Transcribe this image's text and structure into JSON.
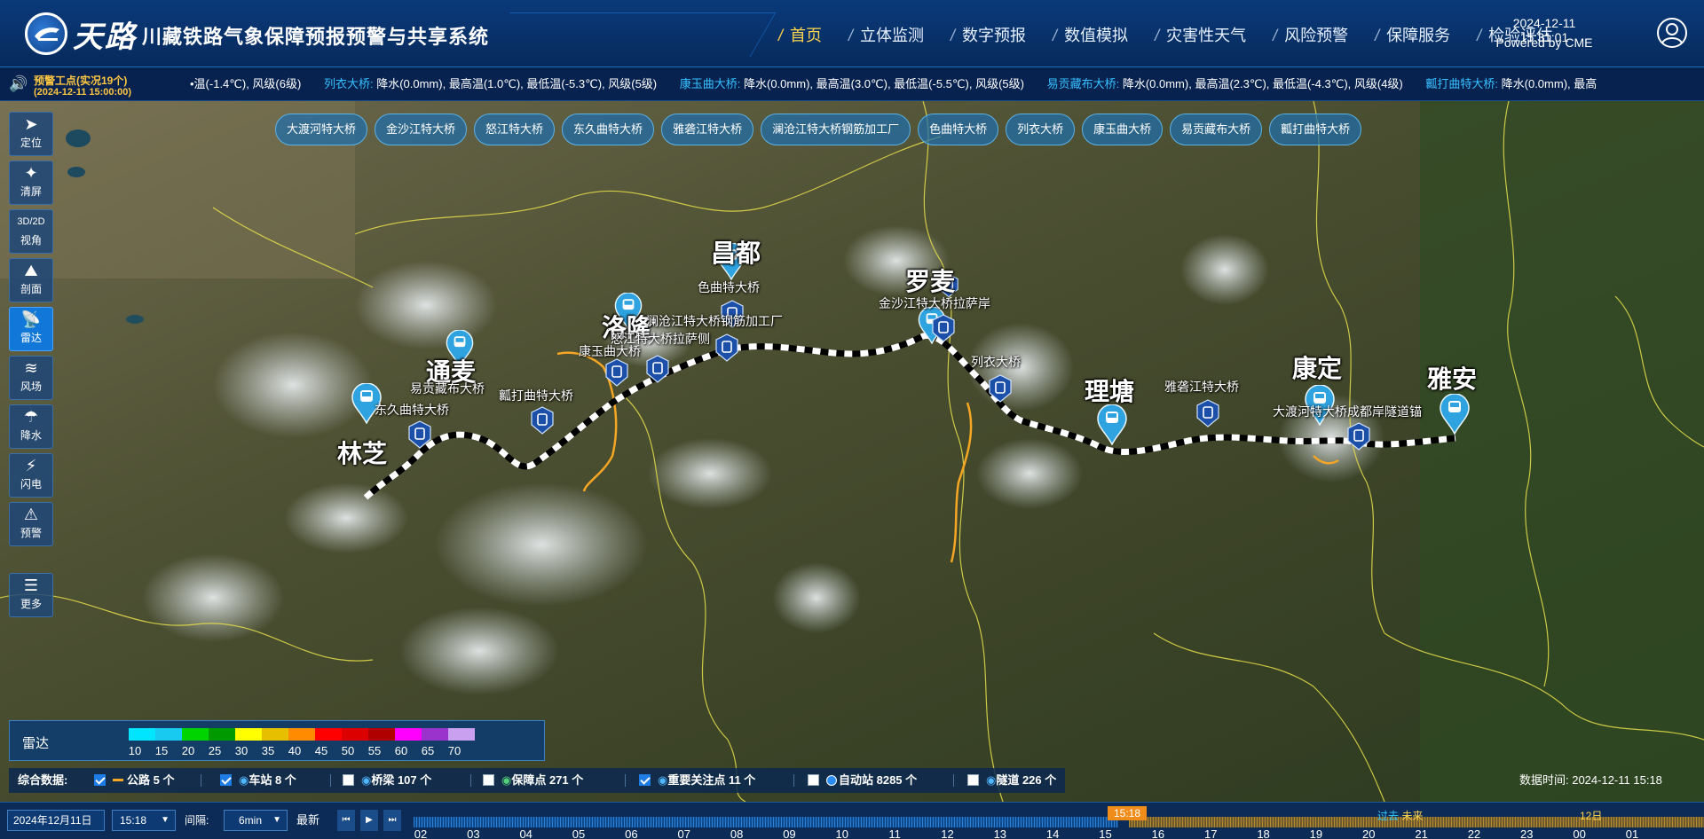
{
  "header": {
    "brand": "天路",
    "title": "川藏铁路气象保障预报预警与共享系统",
    "nav": [
      "首页",
      "立体监测",
      "数字预报",
      "数值模拟",
      "灾害性天气",
      "风险预警",
      "保障服务",
      "检验评估"
    ],
    "active_nav": "首页",
    "datetime": "2024-12-11 15:31:01",
    "powered_by": "Powered by CME"
  },
  "ticker": {
    "alert_title": "预警工点(实况19个)",
    "alert_time": "(2024-12-11 15:00:00)",
    "lead_fragment": "•温(-1.4℃), 风级(6级)",
    "items": [
      {
        "name": "列衣大桥:",
        "text": "降水(0.0mm), 最高温(1.0℃), 最低温(-5.3℃), 风级(5级)"
      },
      {
        "name": "康玉曲大桥:",
        "text": "降水(0.0mm), 最高温(3.0℃), 最低温(-5.5℃), 风级(5级)"
      },
      {
        "name": "易贡藏布大桥:",
        "text": "降水(0.0mm), 最高温(2.3℃), 最低温(-4.3℃), 风级(4级)"
      },
      {
        "name": "瓤打曲特大桥:",
        "text": "降水(0.0mm), 最高"
      }
    ]
  },
  "tools": [
    {
      "label": "定位",
      "icon": "locate-icon"
    },
    {
      "label": "清屏",
      "icon": "clear-icon"
    },
    {
      "label": "视角",
      "icon": "view-angle-icon"
    },
    {
      "label": "剖面",
      "icon": "profile-icon"
    },
    {
      "label": "雷达",
      "icon": "radar-icon"
    },
    {
      "label": "风场",
      "icon": "wind-icon"
    },
    {
      "label": "降水",
      "icon": "rain-icon"
    },
    {
      "label": "闪电",
      "icon": "lightning-icon"
    },
    {
      "label": "预警",
      "icon": "warning-icon"
    }
  ],
  "tool_more": {
    "label": "更多",
    "icon": "layers-icon"
  },
  "active_tool": "雷达",
  "bridge_pills": [
    "大渡河特大桥",
    "金沙江特大桥",
    "怒江特大桥",
    "东久曲特大桥",
    "雅砻江特大桥",
    "澜沧江特大桥钢筋加工厂",
    "色曲特大桥",
    "列衣大桥",
    "康玉曲大桥",
    "易贡藏布大桥",
    "瓤打曲特大桥"
  ],
  "map": {
    "cities": [
      "昌都",
      "罗麦",
      "洛隆",
      "通麦",
      "林芝",
      "理塘",
      "康定",
      "雅安"
    ],
    "pois": [
      "色曲特大桥",
      "澜沧江特大桥钢筋加工厂",
      "金沙江特大桥拉萨岸",
      "怒江特大桥拉萨侧",
      "康玉曲大桥",
      "列衣大桥",
      "易贡藏布大桥",
      "瓤打曲特大桥",
      "东久曲特大桥",
      "雅砻江特大桥",
      "大渡河特大桥成都岸隧道锚"
    ]
  },
  "legend": {
    "title": "雷达",
    "colors": [
      "#00e5ff",
      "#18c9f0",
      "#00d400",
      "#009a00",
      "#ffff00",
      "#e6c000",
      "#ff8c00",
      "#ff0000",
      "#dd0000",
      "#b00000",
      "#ff00ff",
      "#9a33cc",
      "#c9a0f0"
    ],
    "ticks": [
      "10",
      "15",
      "20",
      "25",
      "30",
      "35",
      "40",
      "45",
      "50",
      "55",
      "60",
      "65",
      "70"
    ]
  },
  "databar": {
    "label": "综合数据:",
    "items": [
      {
        "text": "公路 5 个",
        "checked": true,
        "icon": "road-line-icon"
      },
      {
        "text": "车站 8 个",
        "checked": true,
        "icon": "station-pin-icon"
      },
      {
        "text": "桥梁 107 个",
        "checked": false,
        "icon": "bridge-pin-icon"
      },
      {
        "text": "保障点 271 个",
        "checked": false,
        "icon": "support-pin-icon"
      },
      {
        "text": "重要关注点 11 个",
        "checked": true,
        "icon": "focus-pin-icon"
      },
      {
        "text": "自动站 8285 个",
        "checked": false,
        "icon": "auto-station-dot-icon"
      },
      {
        "text": "隧道 226 个",
        "checked": false,
        "icon": "tunnel-pin-icon"
      }
    ],
    "data_time": "数据时间:  2024-12-11 15:18"
  },
  "timeline": {
    "date": "2024年12月11日",
    "time": "15:18",
    "interval_label": "间隔:",
    "interval": "6min",
    "latest_label": "最新",
    "current_label": "15:18",
    "past_label": "过去",
    "future_label": "未来",
    "next_day": "12日",
    "hours": [
      "02",
      "03",
      "04",
      "05",
      "06",
      "07",
      "08",
      "09",
      "10",
      "11",
      "12",
      "13",
      "14",
      "15",
      "16",
      "17",
      "18",
      "19",
      "20",
      "21",
      "22",
      "23",
      "00",
      "01"
    ]
  }
}
